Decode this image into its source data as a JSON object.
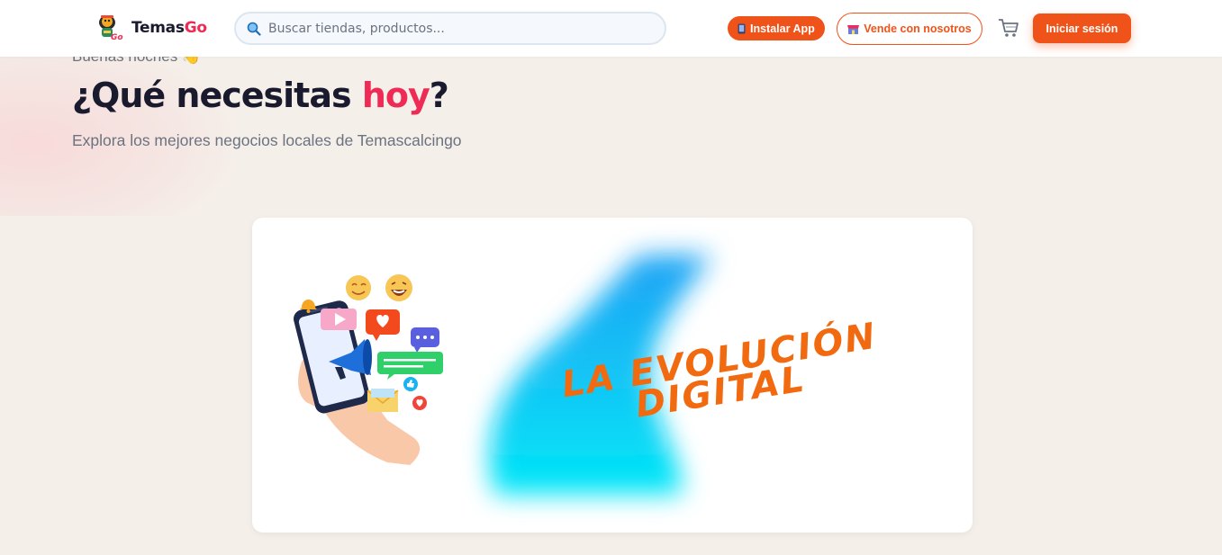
{
  "header": {
    "logo_text_main": "Temas",
    "logo_text_accent": "Go",
    "search_placeholder": "Buscar tiendas, productos...",
    "install_label": "Instalar App",
    "sell_label": "Vende con nosotros",
    "login_label": "Iniciar sesión",
    "icons": {
      "search": "search-icon",
      "install": "phone-icon",
      "sell": "store-icon",
      "cart": "cart-icon"
    }
  },
  "hero": {
    "greeting": "Buenas noches 👋",
    "headline_prefix": "¿Qué necesitas ",
    "headline_highlight": "hoy",
    "headline_suffix": "?",
    "subtitle": "Explora los mejores negocios locales de Temascalcingo"
  },
  "banner": {
    "line1": "LA EVOLUCIÓN",
    "line2": "DIGITAL"
  },
  "colors": {
    "brand_orange": "#f0531a",
    "brand_pink": "#ee2a55",
    "background": "#f5efea"
  }
}
